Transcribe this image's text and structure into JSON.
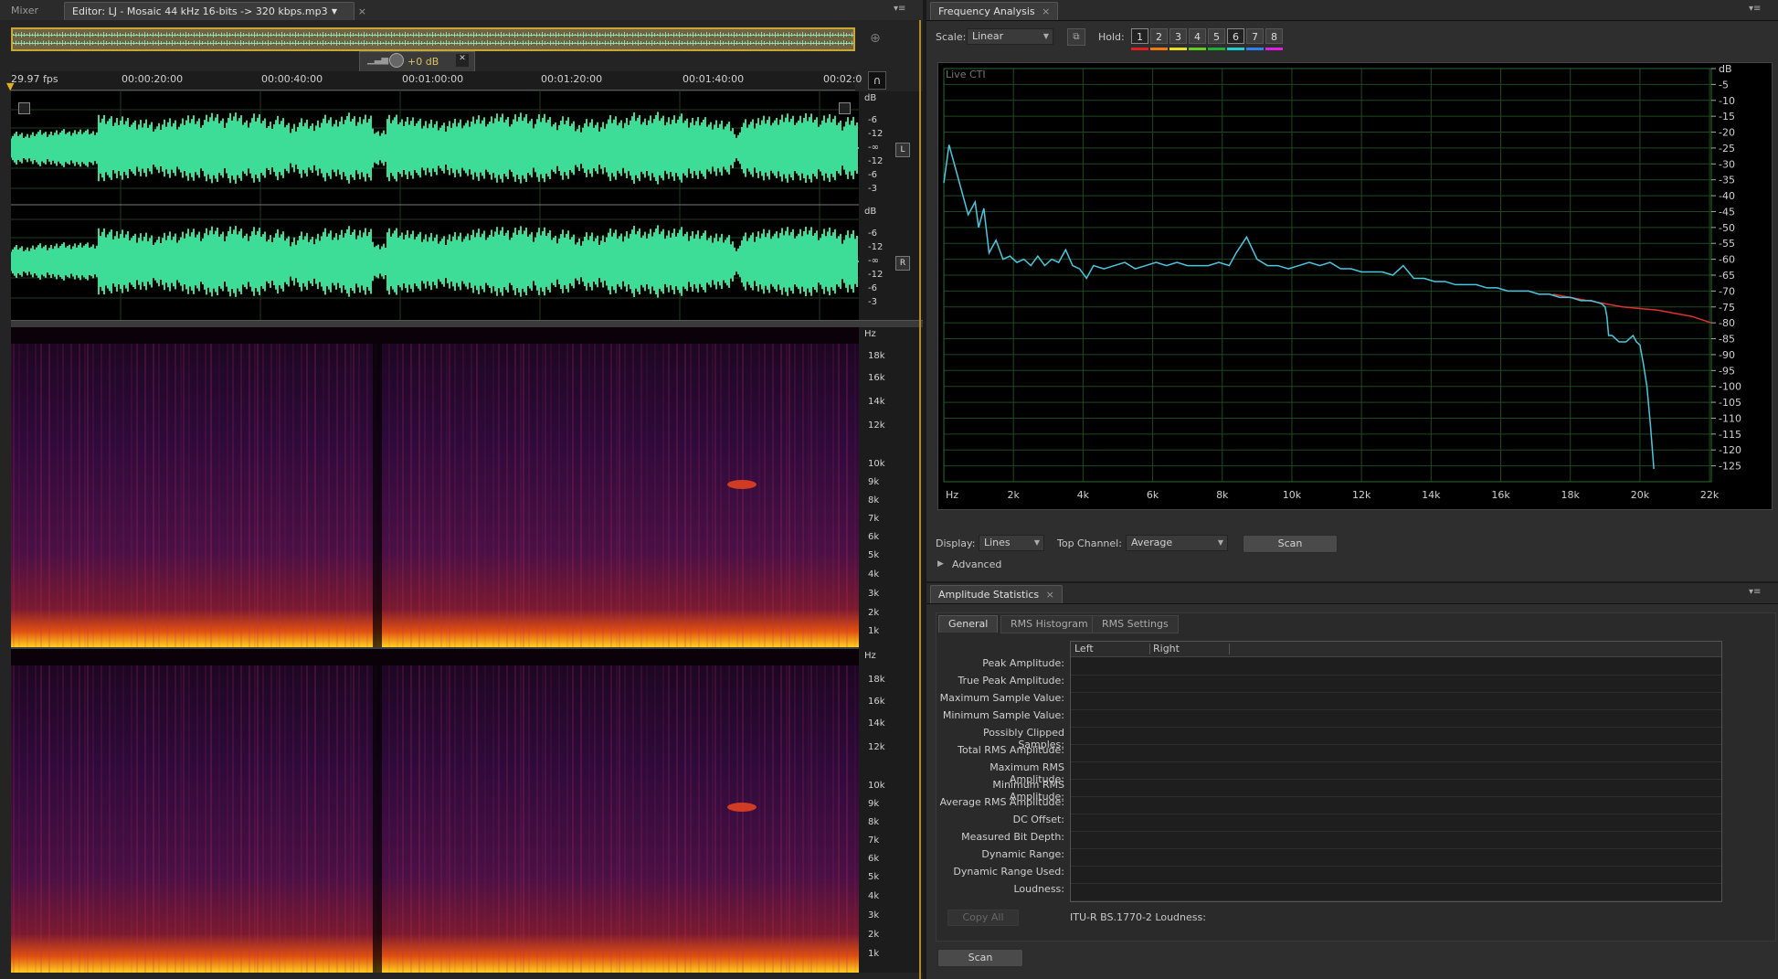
{
  "editor": {
    "tabs": [
      {
        "label": "Mixer"
      },
      {
        "label": "Editor: LJ - Mosaic 44 kHz 16-bits -> 320 kbps.mp3"
      }
    ],
    "hud_gain": "+0 dB",
    "ruler": {
      "fps": "29.97 fps",
      "ticks": [
        "00:00:20:00",
        "00:00:40:00",
        "00:01:00:00",
        "00:01:20:00",
        "00:01:40:00",
        "00:02:0"
      ]
    },
    "channel_L": "L",
    "channel_R": "R",
    "db_unit": "dB",
    "db_scale": [
      "-6",
      "-12",
      "-∞",
      "-12",
      "-6",
      "-3"
    ],
    "hz_unit": "Hz",
    "hz_scale": [
      "18k",
      "16k",
      "14k",
      "12k",
      "10k",
      "9k",
      "8k",
      "7k",
      "6k",
      "5k",
      "4k",
      "3k",
      "2k",
      "1k"
    ],
    "waveform_color": "#3ddc97"
  },
  "frequency_analysis": {
    "title": "Frequency Analysis",
    "scale_label": "Scale:",
    "scale_value": "Linear",
    "hold_label": "Hold:",
    "hold_buttons": [
      {
        "label": "1",
        "color": "#e02020"
      },
      {
        "label": "2",
        "color": "#f07a10"
      },
      {
        "label": "3",
        "color": "#e8e020"
      },
      {
        "label": "4",
        "color": "#60d020"
      },
      {
        "label": "5",
        "color": "#20b030"
      },
      {
        "label": "6",
        "color": "#20d0d0"
      },
      {
        "label": "7",
        "color": "#3080f0"
      },
      {
        "label": "8",
        "color": "#e020e0"
      }
    ],
    "live_cti": "Live CTI",
    "display_label": "Display:",
    "display_value": "Lines",
    "top_channel_label": "Top Channel:",
    "top_channel_value": "Average",
    "scan_label": "Scan",
    "advanced_label": "Advanced"
  },
  "chart_data": {
    "type": "line",
    "xlabel": "Hz",
    "ylabel": "dB",
    "x_ticks": [
      "Hz",
      "2k",
      "4k",
      "6k",
      "8k",
      "10k",
      "12k",
      "14k",
      "16k",
      "18k",
      "20k",
      "22k"
    ],
    "y_ticks": [
      "dB",
      "-5",
      "-10",
      "-15",
      "-20",
      "-25",
      "-30",
      "-35",
      "-40",
      "-45",
      "-50",
      "-55",
      "-60",
      "-65",
      "-70",
      "-75",
      "-80",
      "-85",
      "-90",
      "-95",
      "-100",
      "-105",
      "-110",
      "-115",
      "-120",
      "-125"
    ],
    "xlim": [
      0,
      22050
    ],
    "ylim": [
      -130,
      0
    ],
    "grid": true,
    "series": [
      {
        "color": "#e03030",
        "x": [
          17500,
          18000,
          18500,
          19000,
          19500,
          20000,
          20500,
          21000,
          21500,
          22050
        ],
        "y": [
          -71,
          -72,
          -73,
          -74,
          -75,
          -75.5,
          -76,
          -77,
          -78,
          -80
        ]
      },
      {
        "color": "#4ac8e0",
        "x": [
          0,
          150,
          300,
          500,
          700,
          900,
          1000,
          1150,
          1300,
          1500,
          1700,
          1900,
          2100,
          2300,
          2500,
          2700,
          2900,
          3100,
          3300,
          3500,
          3700,
          3900,
          4100,
          4300,
          4600,
          4900,
          5200,
          5500,
          5800,
          6100,
          6400,
          6700,
          7000,
          7300,
          7600,
          7900,
          8200,
          8400,
          8700,
          9000,
          9300,
          9600,
          9900,
          10200,
          10500,
          10800,
          11100,
          11400,
          11700,
          12000,
          12300,
          12600,
          12900,
          13200,
          13500,
          13800,
          14100,
          14400,
          14700,
          15000,
          15300,
          15600,
          15900,
          16200,
          16500,
          16800,
          17100,
          17400,
          17700,
          18000,
          18300,
          18600,
          18900,
          19000,
          19050,
          19100,
          19200,
          19400,
          19600,
          19800,
          19900,
          20000,
          20100,
          20200,
          20300,
          20400
        ],
        "y": [
          -36,
          -24,
          -30,
          -38,
          -46,
          -42,
          -50,
          -44,
          -58,
          -54,
          -60,
          -59,
          -61,
          -60,
          -62,
          -59,
          -62,
          -60,
          -61,
          -57,
          -62,
          -63,
          -66,
          -62,
          -63,
          -62,
          -61,
          -63,
          -62,
          -61,
          -62,
          -61,
          -62,
          -62,
          -62,
          -61,
          -62,
          -58,
          -53,
          -60,
          -62,
          -62,
          -63,
          -62,
          -61,
          -62,
          -61,
          -63,
          -63,
          -64,
          -64,
          -64,
          -65,
          -62,
          -66,
          -66,
          -67,
          -67,
          -68,
          -68,
          -68,
          -69,
          -69,
          -70,
          -70,
          -70,
          -71,
          -71,
          -72,
          -72,
          -73,
          -73,
          -74,
          -75,
          -78,
          -84,
          -84,
          -86,
          -86,
          -84,
          -86,
          -87,
          -93,
          -100,
          -112,
          -126
        ]
      }
    ]
  },
  "amplitude_statistics": {
    "title": "Amplitude Statistics",
    "tabs": [
      {
        "label": "General"
      },
      {
        "label": "RMS Histogram"
      },
      {
        "label": "RMS Settings"
      }
    ],
    "columns": [
      "Left",
      "Right"
    ],
    "rows": [
      "Peak Amplitude:",
      "True Peak Amplitude:",
      "Maximum Sample Value:",
      "Minimum Sample Value:",
      "Possibly Clipped Samples:",
      "Total RMS Amplitude:",
      "Maximum RMS Amplitude:",
      "Minimum RMS Amplitude:",
      "Average RMS Amplitude:",
      "DC Offset:",
      "Measured Bit Depth:",
      "Dynamic Range:",
      "Dynamic Range Used:",
      "Loudness:"
    ],
    "copy_all_label": "Copy All",
    "loudness_label": "ITU-R BS.1770-2 Loudness:",
    "scan_label": "Scan"
  }
}
